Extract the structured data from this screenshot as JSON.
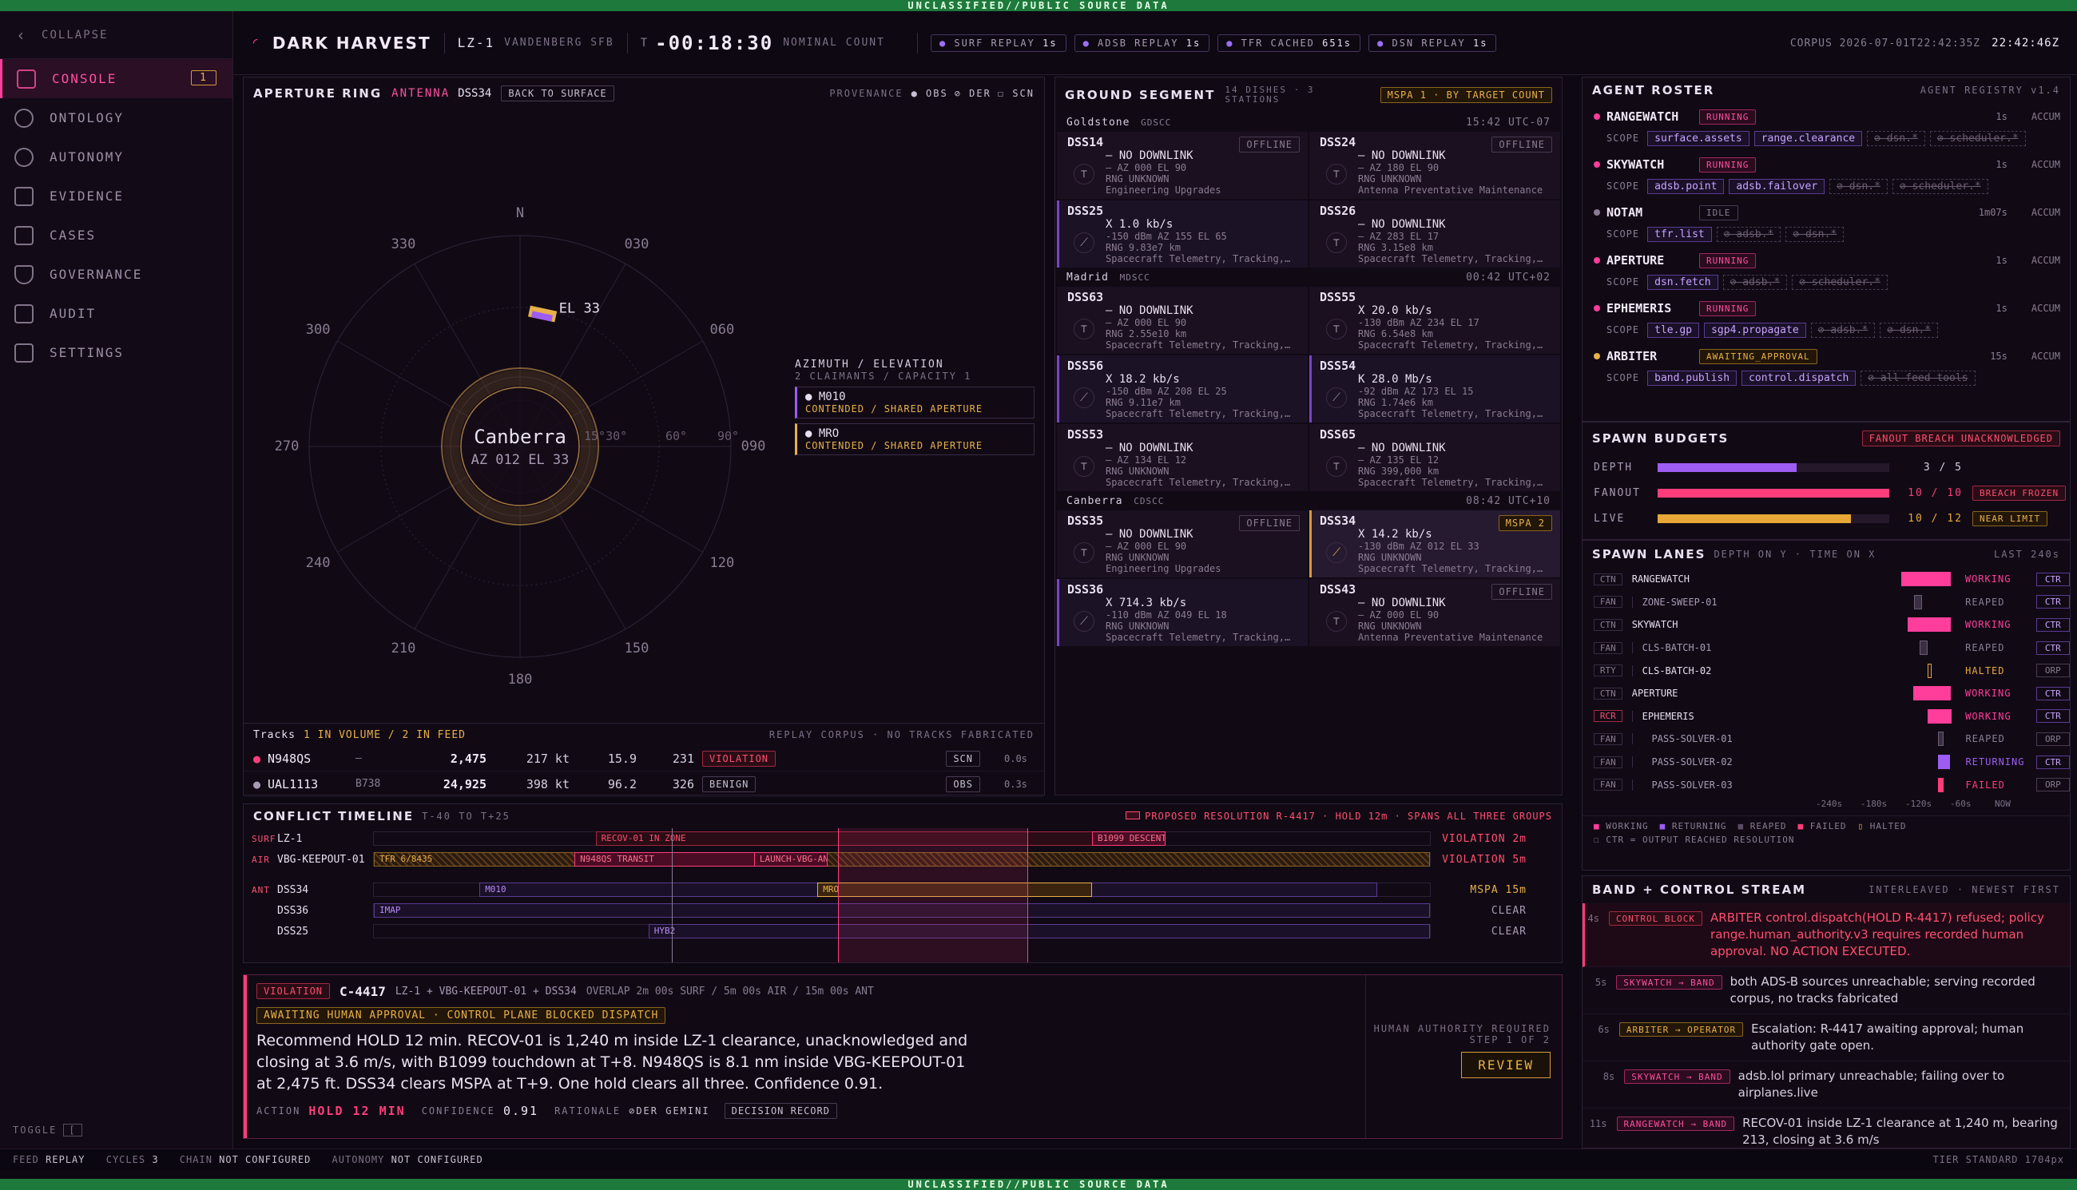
{
  "banner": "UNCLASSIFIED//PUBLIC SOURCE DATA",
  "sidebar": {
    "collapse": "COLLAPSE",
    "items": [
      {
        "label": "CONSOLE",
        "badge": "1"
      },
      {
        "label": "ONTOLOGY"
      },
      {
        "label": "AUTONOMY"
      },
      {
        "label": "EVIDENCE"
      },
      {
        "label": "CASES"
      },
      {
        "label": "GOVERNANCE"
      },
      {
        "label": "AUDIT"
      },
      {
        "label": "SETTINGS"
      }
    ],
    "toggle": "TOGGLE",
    "toggle_key": "["
  },
  "header": {
    "mission": "DARK HARVEST",
    "pad": "LZ-1",
    "site": "VANDENBERG SFB",
    "t_label": "T",
    "clock": "-00:18:30",
    "count": "NOMINAL COUNT",
    "feeds": [
      {
        "name": "SURF REPLAY",
        "val": "1s"
      },
      {
        "name": "ADSB REPLAY",
        "val": "1s"
      },
      {
        "name": "TFR CACHED",
        "val": "651s"
      },
      {
        "name": "DSN REPLAY",
        "val": "1s"
      }
    ],
    "corpus": "CORPUS 2026-07-01T22:42:35Z",
    "time": "22:42:46Z"
  },
  "aperture": {
    "title": "APERTURE RING",
    "mode": "ANTENNA",
    "dish": "DSS34",
    "back": "BACK TO SURFACE",
    "prov": "PROVENANCE",
    "obs": "OBS",
    "der": "DER",
    "scn": "SCN",
    "compass": {
      "n": "N",
      "b030": "030",
      "b060": "060",
      "b090": "090",
      "b120": "120",
      "b150": "150",
      "b180": "180",
      "b210": "210",
      "b240": "240",
      "b270": "270",
      "b300": "300",
      "b330": "330"
    },
    "center": "Canberra",
    "center_sub": "AZ 012 EL 33",
    "el_marker": "EL 33",
    "rings": [
      "15°30°",
      "60°",
      "90°"
    ],
    "azel_title": "AZIMUTH / ELEVATION",
    "azel_sub": "2 CLAIMANTS / CAPACITY 1",
    "claimants": [
      {
        "name": "M010",
        "status": "CONTENDED / SHARED APERTURE"
      },
      {
        "name": "MRO",
        "status": "CONTENDED / SHARED APERTURE"
      }
    ],
    "tracks_title": "Tracks",
    "tracks_sub": "1 IN VOLUME / 2 IN FEED",
    "tracks_note": "REPLAY CORPUS · NO TRACKS FABRICATED",
    "tracks": [
      {
        "id": "N948QS",
        "type": "—",
        "alt": "2,475",
        "spd": "217 kt",
        "dist": "15.9",
        "hdg": "231",
        "status": "VIOLATION",
        "src": "SCN",
        "age": "0.0s"
      },
      {
        "id": "UAL1113",
        "type": "B738",
        "alt": "24,925",
        "spd": "398 kt",
        "dist": "96.2",
        "hdg": "326",
        "status": "BENIGN",
        "src": "OBS",
        "age": "0.3s"
      }
    ]
  },
  "ground": {
    "title": "GROUND SEGMENT",
    "sub1": "14 DISHES · 3",
    "sub2": "STATIONS",
    "mspa": "MSPA 1 · BY TARGET COUNT",
    "stations": [
      {
        "name": "Goldstone",
        "code": "GDSCC",
        "time": "15:42 UTC-07",
        "dishes": [
          {
            "id": "DSS14",
            "status": "OFFLINE",
            "l1": "– NO DOWNLINK",
            "l2": "– AZ 000 EL 90",
            "l3": "RNG UNKNOWN",
            "l4": "Engineering Upgrades",
            "on": false
          },
          {
            "id": "DSS24",
            "status": "OFFLINE",
            "l1": "– NO DOWNLINK",
            "l2": "– AZ 180 EL 90",
            "l3": "RNG UNKNOWN",
            "l4": "Antenna Preventative Maintenance",
            "on": false
          },
          {
            "id": "DSS25",
            "status": "",
            "l1": "X 1.0 kb/s",
            "l2": "-150 dBm AZ 155 EL 65",
            "l3": "RNG 9.83e7 km",
            "l4": "Spacecraft Telemetry, Tracking,…",
            "on": true
          },
          {
            "id": "DSS26",
            "status": "",
            "l1": "– NO DOWNLINK",
            "l2": "– AZ 283 EL 17",
            "l3": "RNG 3.15e8 km",
            "l4": "Spacecraft Telemetry, Tracking,…",
            "on": false
          }
        ]
      },
      {
        "name": "Madrid",
        "code": "MDSCC",
        "time": "00:42 UTC+02",
        "dishes": [
          {
            "id": "DSS63",
            "status": "",
            "l1": "– NO DOWNLINK",
            "l2": "– AZ 000 EL 90",
            "l3": "RNG 2.55e10 km",
            "l4": "Spacecraft Telemetry, Tracking,…",
            "on": false
          },
          {
            "id": "DSS55",
            "status": "",
            "l1": "X 20.0 kb/s",
            "l2": "-130 dBm AZ 234 EL 17",
            "l3": "RNG 6.54e8 km",
            "l4": "Spacecraft Telemetry, Tracking,…",
            "on": false
          },
          {
            "id": "DSS56",
            "status": "",
            "l1": "X 18.2 kb/s",
            "l2": "-150 dBm AZ 208 EL 25",
            "l3": "RNG 9.11e7 km",
            "l4": "Spacecraft Telemetry, Tracking,…",
            "on": true
          },
          {
            "id": "DSS54",
            "status": "",
            "l1": "K 28.0 Mb/s",
            "l2": "-92 dBm AZ 173 EL 15",
            "l3": "RNG 1.74e6 km",
            "l4": "Spacecraft Telemetry, Tracking,…",
            "on": true
          },
          {
            "id": "DSS53",
            "status": "",
            "l1": "– NO DOWNLINK",
            "l2": "– AZ 134 EL 12",
            "l3": "RNG UNKNOWN",
            "l4": "Spacecraft Telemetry, Tracking,…",
            "on": false
          },
          {
            "id": "DSS65",
            "status": "",
            "l1": "– NO DOWNLINK",
            "l2": "– AZ 135 EL 12",
            "l3": "RNG 399,000 km",
            "l4": "Spacecraft Telemetry, Tracking,…",
            "on": false
          }
        ]
      },
      {
        "name": "Canberra",
        "code": "CDSCC",
        "time": "08:42 UTC+10",
        "dishes": [
          {
            "id": "DSS35",
            "status": "OFFLINE",
            "l1": "– NO DOWNLINK",
            "l2": "– AZ 000 EL 90",
            "l3": "RNG UNKNOWN",
            "l4": "Engineering Upgrades",
            "on": false
          },
          {
            "id": "DSS34",
            "status": "MSPA 2",
            "l1": "X 14.2 kb/s",
            "l2": "-130 dBm AZ 012 EL 33",
            "l3": "RNG UNKNOWN",
            "l4": "Spacecraft Telemetry, Tracking,…",
            "on": true,
            "mspa": true
          },
          {
            "id": "DSS36",
            "status": "",
            "l1": "X 714.3 kb/s",
            "l2": "-110 dBm AZ 049 EL 18",
            "l3": "RNG UNKNOWN",
            "l4": "Spacecraft Telemetry, Tracking,…",
            "on": true
          },
          {
            "id": "DSS43",
            "status": "OFFLINE",
            "l1": "– NO DOWNLINK",
            "l2": "– AZ 000 EL 90",
            "l3": "RNG UNKNOWN",
            "l4": "Antenna Preventative Maintenance",
            "on": false
          }
        ]
      }
    ]
  },
  "roster": {
    "title": "AGENT ROSTER",
    "registry": "AGENT REGISTRY v1.4",
    "scope_label": "SCOPE",
    "accum": "ACCUM",
    "agents": [
      {
        "name": "RANGEWATCH",
        "status": "RUNNING",
        "age": "1s",
        "color": "#ff3d9a",
        "scopes": [
          "surface.assets",
          "range.clearance"
        ],
        "denied": [
          "⊘ dsn.*",
          "⊘ scheduler.*"
        ]
      },
      {
        "name": "SKYWATCH",
        "status": "RUNNING",
        "age": "1s",
        "color": "#ff3d9a",
        "scopes": [
          "adsb.point",
          "adsb.failover"
        ],
        "denied": [
          "⊘ dsn.*",
          "⊘ scheduler.*"
        ]
      },
      {
        "name": "NOTAM",
        "status": "IDLE",
        "age": "1m07s",
        "color": "#8a7c92",
        "scopes": [
          "tfr.list"
        ],
        "denied": [
          "⊘ adsb.*",
          "⊘ dsn.*"
        ]
      },
      {
        "name": "APERTURE",
        "status": "RUNNING",
        "age": "1s",
        "color": "#ff3d9a",
        "scopes": [
          "dsn.fetch"
        ],
        "denied": [
          "⊘ adsb.*",
          "⊘ scheduler.*"
        ]
      },
      {
        "name": "EPHEMERIS",
        "status": "RUNNING",
        "age": "1s",
        "color": "#ff3d9a",
        "scopes": [
          "tle.gp",
          "sgp4.propagate"
        ],
        "denied": [
          "⊘ adsb.*",
          "⊘ dsn.*"
        ]
      },
      {
        "name": "ARBITER",
        "status": "AWAITING_APPROVAL",
        "age": "15s",
        "color": "#e8b048",
        "scopes": [
          "band.publish",
          "control.dispatch"
        ],
        "denied": [
          "⊘ all feed tools"
        ]
      }
    ]
  },
  "budgets": {
    "title": "SPAWN BUDGETS",
    "alert": "FANOUT BREACH UNACKNOWLEDGED",
    "rows": [
      {
        "label": "DEPTH",
        "value": 3,
        "max": 5,
        "text": "3 / 5",
        "flag": "",
        "color": "#9d5df2"
      },
      {
        "label": "FANOUT",
        "value": 10,
        "max": 10,
        "text": "10 / 10",
        "flag": "BREACH FROZEN",
        "color": "#ff3d7a"
      },
      {
        "label": "LIVE",
        "value": 10,
        "max": 12,
        "text": "10 / 12",
        "flag": "NEAR LIMIT",
        "color": "#e8a838"
      }
    ]
  },
  "lanes": {
    "title": "SPAWN LANES",
    "sub": "DEPTH ON Y · TIME ON X",
    "window": "LAST 240s",
    "rows": [
      {
        "kind": "CTN",
        "name": "RANGEWATCH",
        "depth": 0,
        "start": 0.68,
        "end": 0.93,
        "state": "WORKING",
        "ctr": "CTR"
      },
      {
        "kind": "FAN",
        "name": "ZONE-SWEEP-01",
        "depth": 1,
        "start": 0.74,
        "end": 0.78,
        "state": "REAPED",
        "ctr": "CTR"
      },
      {
        "kind": "CTN",
        "name": "SKYWATCH",
        "depth": 0,
        "start": 0.71,
        "end": 0.93,
        "state": "WORKING",
        "ctr": "CTR"
      },
      {
        "kind": "FAN",
        "name": "CLS-BATCH-01",
        "depth": 1,
        "start": 0.77,
        "end": 0.81,
        "state": "REAPED",
        "ctr": "CTR"
      },
      {
        "kind": "RTY",
        "name": "CLS-BATCH-02",
        "depth": 1,
        "start": 0.81,
        "end": 0.83,
        "state": "HALTED",
        "ctr": "ORP"
      },
      {
        "kind": "CTN",
        "name": "APERTURE",
        "depth": 0,
        "start": 0.74,
        "end": 0.93,
        "state": "WORKING",
        "ctr": "CTR"
      },
      {
        "kind": "RCR",
        "name": "EPHEMERIS",
        "depth": 1,
        "start": 0.81,
        "end": 0.93,
        "state": "WORKING",
        "ctr": "CTR"
      },
      {
        "kind": "FAN",
        "name": "PASS-SOLVER-01",
        "depth": 2,
        "start": 0.86,
        "end": 0.89,
        "state": "REAPED",
        "ctr": "ORP"
      },
      {
        "kind": "FAN",
        "name": "PASS-SOLVER-02",
        "depth": 2,
        "start": 0.86,
        "end": 0.92,
        "state": "RETURNING",
        "ctr": "CTR"
      },
      {
        "kind": "FAN",
        "name": "PASS-SOLVER-03",
        "depth": 2,
        "start": 0.86,
        "end": 0.89,
        "state": "FAILED",
        "ctr": "ORP"
      }
    ],
    "ticks": [
      "-240s",
      "-180s",
      "-120s",
      "-60s",
      "NOW"
    ],
    "legend": [
      "WORKING",
      "RETURNING",
      "REAPED",
      "FAILED",
      "HALTED"
    ],
    "legend2": "CTR = OUTPUT REACHED RESOLUTION"
  },
  "band": {
    "title": "BAND + CONTROL STREAM",
    "sub": "INTERLEAVED · NEWEST FIRST",
    "items": [
      {
        "t": "4s",
        "src": "CONTROL BLOCK",
        "msg": "ARBITER control.dispatch(HOLD R-4417) refused; policy range.human_authority.v3 requires recorded human approval. NO ACTION EXECUTED.",
        "kind": "block"
      },
      {
        "t": "5s",
        "src": "SKYWATCH → BAND",
        "msg": "both ADS-B sources unreachable; serving recorded corpus, no tracks fabricated",
        "kind": "pink"
      },
      {
        "t": "6s",
        "src": "ARBITER → OPERATOR",
        "msg": "Escalation: R-4417 awaiting approval; human authority gate open.",
        "kind": "amber"
      },
      {
        "t": "8s",
        "src": "SKYWATCH → BAND",
        "msg": "adsb.lol primary unreachable; failing over to airplanes.live",
        "kind": "pink"
      },
      {
        "t": "11s",
        "src": "RANGEWATCH → BAND",
        "msg": "RECOV-01 inside LZ-1 clearance at 1,240 m, bearing 213, closing at 3.6 m/s",
        "kind": "pink"
      }
    ]
  },
  "timeline": {
    "title": "CONFLICT TIMELINE",
    "range": "T-40 TO T+25",
    "proposed": "PROPOSED RESOLUTION R-4417 · HOLD 12m · SPANS ALL THREE GROUPS",
    "rows": [
      {
        "cat": "SURF",
        "name": "LZ-1",
        "result": "VIOLATION 2m",
        "segs": [
          {
            "label": "RECOV-01 IN ZONE",
            "s": 0.21,
            "e": 0.7,
            "k": "red"
          },
          {
            "label": "B1099 DESCENT",
            "s": 0.68,
            "e": 0.75,
            "k": "redfill"
          }
        ]
      },
      {
        "cat": "AIR",
        "name": "VBG-KEEPOUT-01",
        "result": "VIOLATION 5m",
        "segs": [
          {
            "label": "TFR 6/8435",
            "s": 0.0,
            "e": 1.0,
            "k": "hatch"
          },
          {
            "label": "N948QS TRANSIT",
            "s": 0.19,
            "e": 0.4,
            "k": "redfill"
          },
          {
            "label": "LAUNCH-VBG-AN",
            "s": 0.36,
            "e": 0.43,
            "k": "redfill"
          }
        ]
      },
      {
        "cat": "ANT",
        "name": "DSS34",
        "result": "MSPA 15m",
        "segs": [
          {
            "label": "M010",
            "s": 0.1,
            "e": 0.95,
            "k": "violet"
          },
          {
            "label": "MRO",
            "s": 0.42,
            "e": 0.68,
            "k": "amber"
          }
        ]
      },
      {
        "cat": "",
        "name": "DSS36",
        "result": "CLEAR",
        "segs": [
          {
            "label": "IMAP",
            "s": 0.0,
            "e": 1.0,
            "k": "violet"
          }
        ]
      },
      {
        "cat": "",
        "name": "DSS25",
        "result": "CLEAR",
        "segs": [
          {
            "label": "HYB2",
            "s": 0.26,
            "e": 1.0,
            "k": "violet"
          }
        ]
      }
    ]
  },
  "decision": {
    "status": "VIOLATION",
    "id": "C-4417",
    "scope": "LZ-1 + VBG-KEEPOUT-01 + DSS34",
    "overlap": "OVERLAP 2m 00s SURF / 5m 00s AIR / 15m 00s ANT",
    "gate": "AWAITING HUMAN APPROVAL · CONTROL PLANE BLOCKED DISPATCH",
    "text": "Recommend HOLD 12 min. RECOV-01 is 1,240 m inside LZ-1 clearance, unacknowledged and closing at 3.6 m/s, with B1099 touchdown at T+8. N948QS is 8.1 nm inside VBG-KEEPOUT-01 at 2,475 ft. DSS34 clears MSPA at T+9. One hold clears all three. Confidence 0.91.",
    "action_label": "ACTION",
    "action": "HOLD 12 MIN",
    "conf_label": "CONFIDENCE",
    "conf": "0.91",
    "rationale_label": "RATIONALE",
    "rationale": "⊘DER GEMINI",
    "record": "DECISION RECORD",
    "authority": "HUMAN AUTHORITY REQUIRED",
    "step": "STEP 1 OF 2",
    "review": "REVIEW"
  },
  "statusbar": {
    "feed_l": "FEED",
    "feed": "REPLAY",
    "cycles_l": "CYCLES",
    "cycles": "3",
    "chain_l": "CHAIN",
    "chain": "NOT CONFIGURED",
    "auto_l": "AUTONOMY",
    "auto": "NOT CONFIGURED",
    "tier": "TIER STANDARD 1704px"
  }
}
